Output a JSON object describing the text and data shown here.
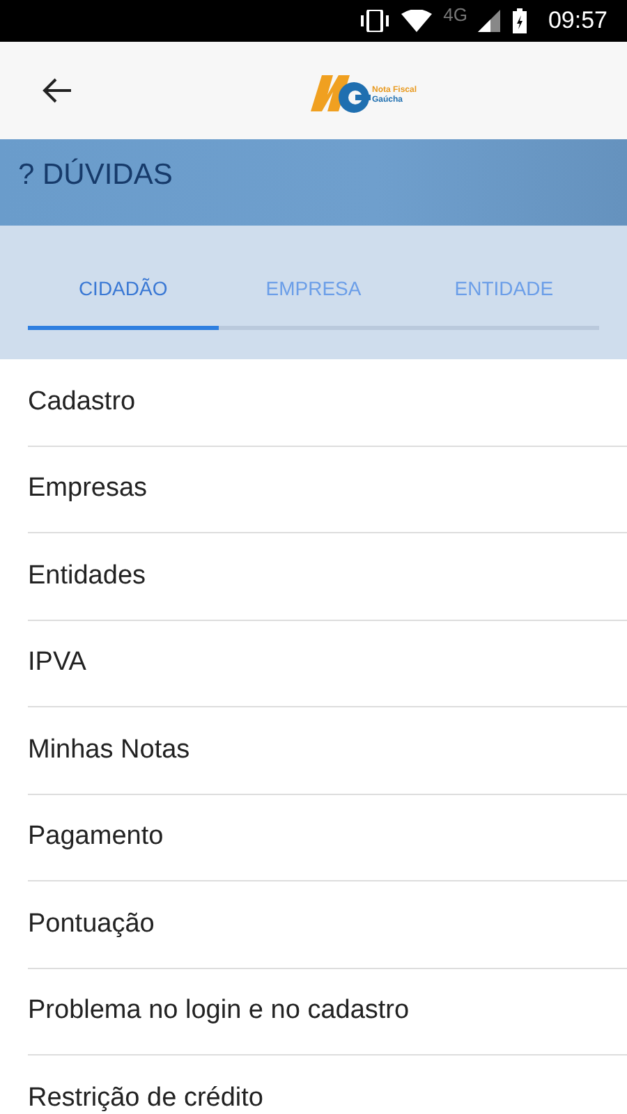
{
  "status_bar": {
    "network": "4G",
    "time": "09:57"
  },
  "app_bar": {
    "logo_text": [
      "Nota Fiscal",
      "Gaúcha"
    ]
  },
  "header": {
    "title": "? DÚVIDAS"
  },
  "tabs": [
    {
      "label": "CIDADÃO",
      "selected": true
    },
    {
      "label": "EMPRESA",
      "selected": false
    },
    {
      "label": "ENTIDADE",
      "selected": false
    }
  ],
  "items": [
    "Cadastro",
    "Empresas",
    "Entidades",
    "IPVA",
    "Minhas Notas",
    "Pagamento",
    "Pontuação",
    "Problema no login e no cadastro",
    "Restrição de crédito"
  ]
}
